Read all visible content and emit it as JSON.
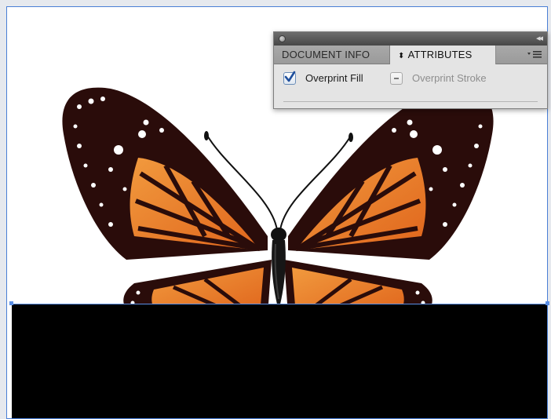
{
  "panel": {
    "tabs": [
      {
        "label": "DOCUMENT INFO",
        "active": false
      },
      {
        "label": "ATTRIBUTES",
        "active": true,
        "icon": "up-down-arrows-icon"
      }
    ],
    "menu_icon": "panel-menu-icon",
    "collapse_icon": "double-chevron-left-icon",
    "close_icon": "close-dot-icon",
    "options": {
      "overprint_fill": {
        "label": "Overprint Fill",
        "checked": true
      },
      "overprint_stroke": {
        "label": "Overprint Stroke",
        "state": "mixed",
        "enabled": false
      }
    }
  },
  "canvas": {
    "artwork": "monarch-butterfly",
    "selection_color": "#4a7fd6",
    "rect_fill": "#000000"
  }
}
